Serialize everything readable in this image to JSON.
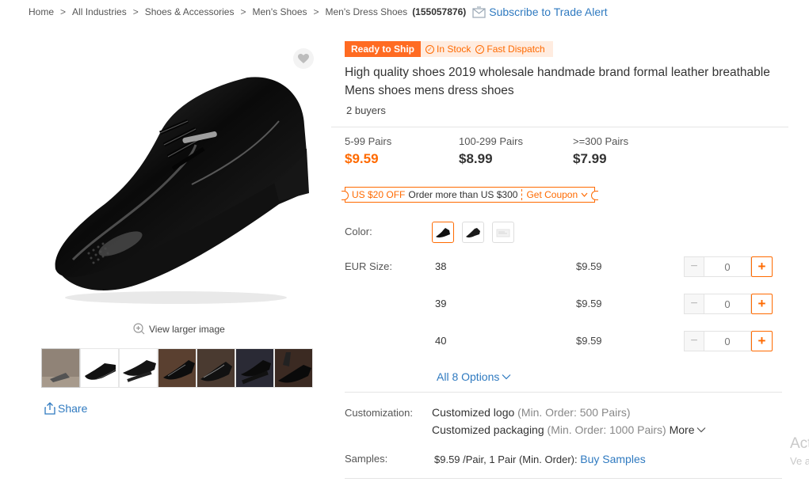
{
  "breadcrumb": {
    "items": [
      "Home",
      "All Industries",
      "Shoes & Accessories",
      "Men's Shoes",
      "Men's Dress Shoes"
    ],
    "separator": ">",
    "product_id": "(155057876)",
    "trade_alert": "Subscribe to Trade Alert"
  },
  "gallery": {
    "view_larger": "View larger image",
    "share": "Share",
    "thumbnail_count": 7
  },
  "product": {
    "badge_ready": "Ready to Ship",
    "badge_stock": "In Stock",
    "badge_dispatch": "Fast Dispatch",
    "title": "High quality shoes 2019 wholesale handmade brand formal leather breathable Mens shoes mens dress shoes",
    "buyers": "2 buyers"
  },
  "pricing": {
    "tiers": [
      {
        "qty": "5-99 Pairs",
        "price": "$9.59"
      },
      {
        "qty": "100-299 Pairs",
        "price": "$8.99"
      },
      {
        "qty": ">=300 Pairs",
        "price": "$7.99"
      }
    ]
  },
  "coupon": {
    "amount": "US $20 OFF",
    "condition": "Order more than US $300",
    "action": "Get Coupon"
  },
  "options": {
    "color_label": "Color:",
    "size_label": "EUR Size:",
    "sizes": [
      {
        "size": "38",
        "price": "$9.59",
        "qty": "0"
      },
      {
        "size": "39",
        "price": "$9.59",
        "qty": "0"
      },
      {
        "size": "40",
        "price": "$9.59",
        "qty": "0"
      }
    ],
    "all_options": "All 8 Options"
  },
  "customization": {
    "label": "Customization:",
    "logo": "Customized logo",
    "logo_moq": "(Min. Order: 500 Pairs)",
    "packaging": "Customized packaging",
    "packaging_moq": "(Min. Order: 1000 Pairs)",
    "more": "More"
  },
  "samples": {
    "label": "Samples:",
    "text": "$9.59 /Pair, 1 Pair (Min. Order):",
    "link": "Buy Samples"
  },
  "watermark": {
    "line1": "Act",
    "line2": "Ve a"
  },
  "colors": {
    "accent": "#ff6a00",
    "link": "#2f7ac0",
    "ready_badge": "#ff6b22"
  }
}
